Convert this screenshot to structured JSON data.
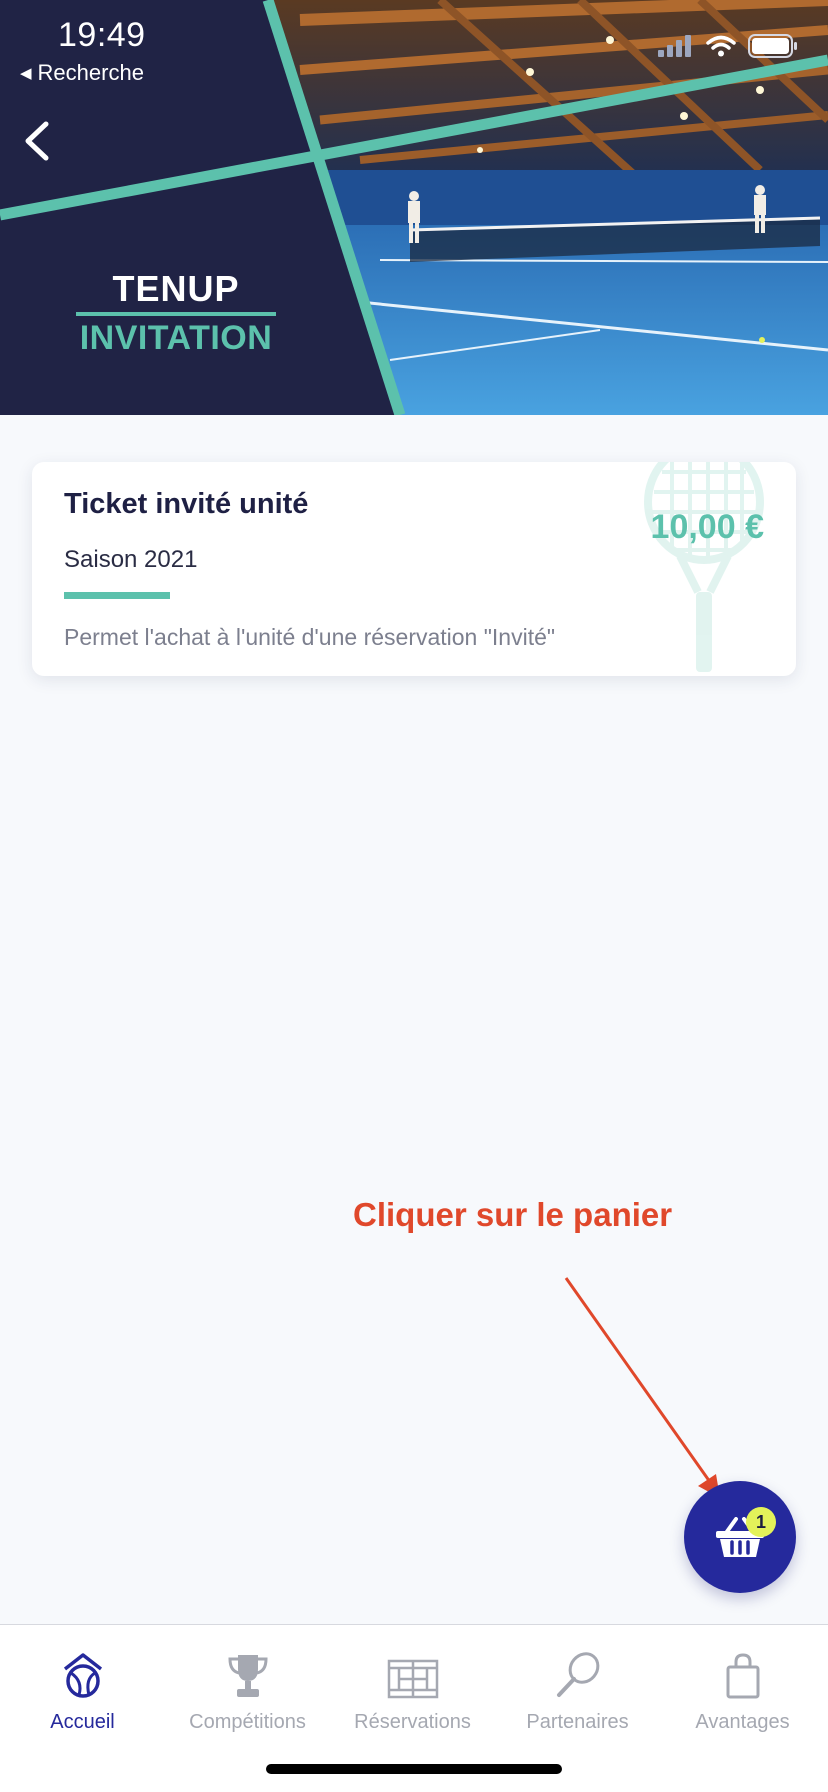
{
  "status_bar": {
    "time": "19:49",
    "back_app_label": "Recherche",
    "icons": [
      "signal-icon",
      "wifi-icon",
      "battery-icon"
    ]
  },
  "header": {
    "back_icon": "chevron-left-icon",
    "logo": {
      "top": "TENUP",
      "bottom": "INVITATION"
    }
  },
  "product_card": {
    "title": "Ticket invité unité",
    "subtitle": "Saison 2021",
    "description": "Permet l'achat à l'unité d'une réservation \"Invité\"",
    "price": "10,00 €",
    "decoration_icon": "tennis-racket-icon"
  },
  "annotation": {
    "text": "Cliquer sur le panier",
    "color": "#e0482b"
  },
  "basket": {
    "icon": "basket-icon",
    "count": "1"
  },
  "tabbar": {
    "items": [
      {
        "label": "Accueil",
        "icon": "tennis-home-icon",
        "active": true
      },
      {
        "label": "Compétitions",
        "icon": "trophy-icon",
        "active": false
      },
      {
        "label": "Réservations",
        "icon": "court-icon",
        "active": false
      },
      {
        "label": "Partenaires",
        "icon": "racket-icon",
        "active": false
      },
      {
        "label": "Avantages",
        "icon": "shopping-bag-icon",
        "active": false
      }
    ]
  },
  "colors": {
    "navy": "#202345",
    "accent_teal": "#5cc1ac",
    "primary_blue": "#25299c",
    "badge_yellow": "#e3f25a",
    "court_blue": "#3a8fd0"
  }
}
